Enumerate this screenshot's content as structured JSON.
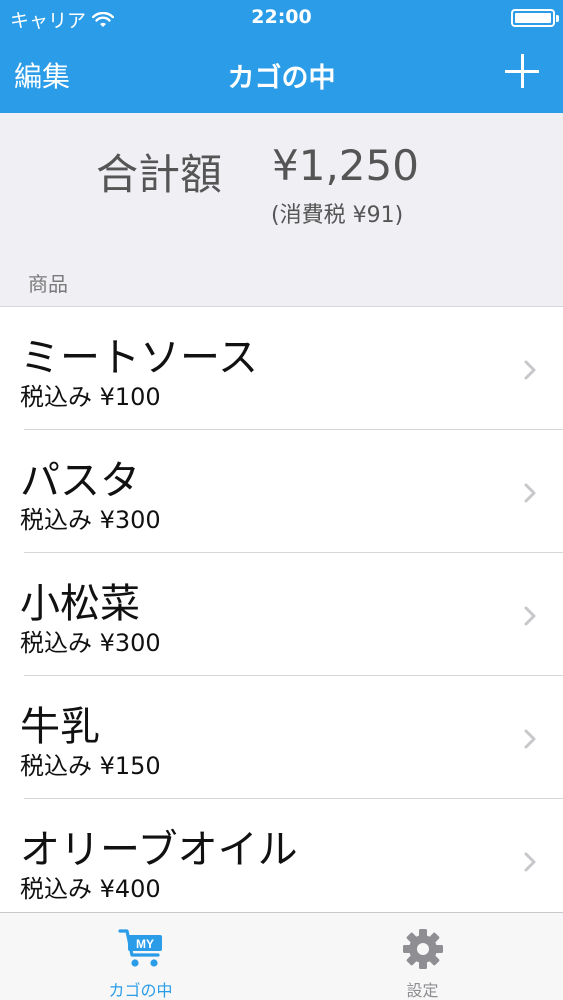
{
  "status_bar": {
    "carrier": "キャリア",
    "time": "22:00"
  },
  "nav": {
    "edit_label": "編集",
    "title": "カゴの中",
    "add_icon": "plus-icon"
  },
  "summary": {
    "total_label": "合計額",
    "total_amount": "¥1,250",
    "tax": "(消費税 ¥91)"
  },
  "section_header": "商品",
  "items": [
    {
      "name": "ミートソース",
      "price": "税込み ¥100"
    },
    {
      "name": "パスタ",
      "price": "税込み ¥300"
    },
    {
      "name": "小松菜",
      "price": "税込み ¥300"
    },
    {
      "name": "牛乳",
      "price": "税込み ¥150"
    },
    {
      "name": "オリーブオイル",
      "price": "税込み ¥400"
    }
  ],
  "tabbar": {
    "cart_label": "カゴの中",
    "cart_badge": "MY",
    "settings_label": "設定"
  },
  "colors": {
    "accent": "#2b9de8",
    "inactive": "#8e8e93",
    "background": "#efeff4"
  }
}
